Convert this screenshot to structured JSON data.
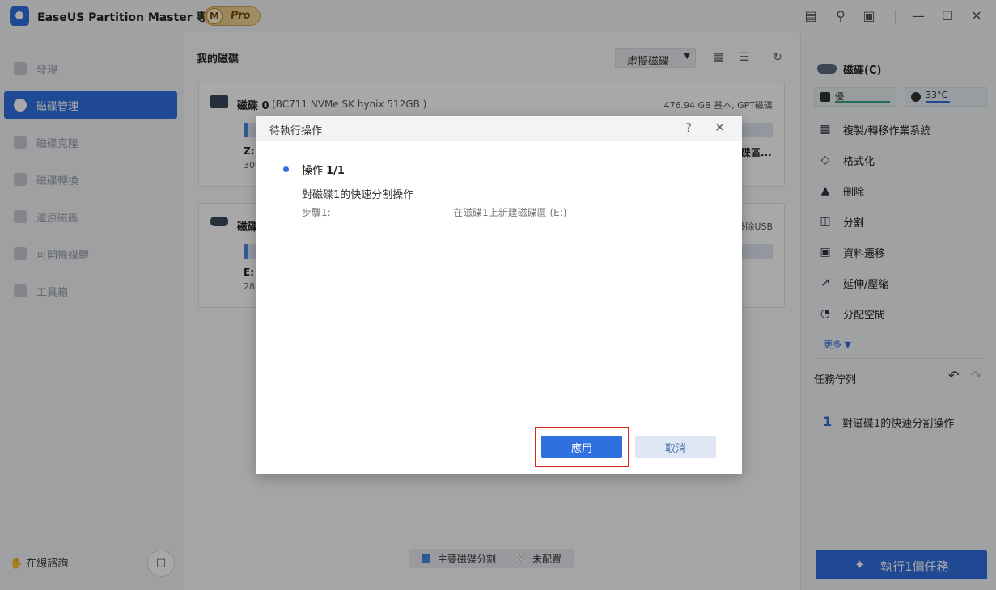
{
  "titlebar": {
    "app_title": "EaseUS Partition Master 專業版",
    "pro_m": "M",
    "pro_label": "Pro"
  },
  "sidebar": {
    "items": [
      {
        "label": "發現",
        "icon": "compass-icon"
      },
      {
        "label": "磁碟管理",
        "icon": "pie-chart-icon"
      },
      {
        "label": "磁碟克隆",
        "icon": "clone-icon"
      },
      {
        "label": "磁碟轉換",
        "icon": "convert-icon"
      },
      {
        "label": "還原磁區",
        "icon": "recover-icon"
      },
      {
        "label": "可開機媒體",
        "icon": "usb-icon"
      },
      {
        "label": "工具箱",
        "icon": "toolbox-icon"
      }
    ],
    "online_chat": "在線諮詢"
  },
  "main": {
    "title": "我的磁碟",
    "virtual_disk_btn": "虛擬磁碟",
    "disks": [
      {
        "name": "磁碟 0",
        "model": "(BC711 NVMe SK hynix 512GB )",
        "info": "476.94 GB 基本, GPT磁碟",
        "partition_label": "Z:",
        "partition_size": "300",
        "partition_right": "碟區..."
      },
      {
        "name": "磁碟",
        "info": "移除USB",
        "partition_label": "E: (",
        "partition_size": "28."
      }
    ],
    "legend": {
      "primary": "主要磁碟分割",
      "unallocated": "未配置"
    }
  },
  "rpanel": {
    "disk_title": "磁碟(C)",
    "health": "優",
    "temperature": "33°C",
    "operations": [
      {
        "label": "複製/轉移作業系統",
        "icon": "windows-icon"
      },
      {
        "label": "格式化",
        "icon": "format-icon"
      },
      {
        "label": "刪除",
        "icon": "trash-icon"
      },
      {
        "label": "分割",
        "icon": "split-icon"
      },
      {
        "label": "資料遷移",
        "icon": "migrate-icon"
      },
      {
        "label": "延伸/壓縮",
        "icon": "resize-icon"
      },
      {
        "label": "分配空間",
        "icon": "allocate-icon"
      }
    ],
    "more": "更多 ▼",
    "task_queue_title": "任務佇列",
    "task_items": [
      {
        "num": "1",
        "text": "對磁碟1的快速分割操作"
      }
    ],
    "execute_btn": "執行1個任務"
  },
  "dialog": {
    "title": "待執行操作",
    "op_prefix": "操作 ",
    "op_count": "1/1",
    "op_desc": "對磁碟1的快速分割操作",
    "step_label": "步驟1:",
    "step_value": "在磁碟1上新建磁碟區  (E:)",
    "apply_btn": "應用",
    "cancel_btn": "取消"
  },
  "colors": {
    "accent": "#2f6fde",
    "highlight": "#e0261c"
  }
}
